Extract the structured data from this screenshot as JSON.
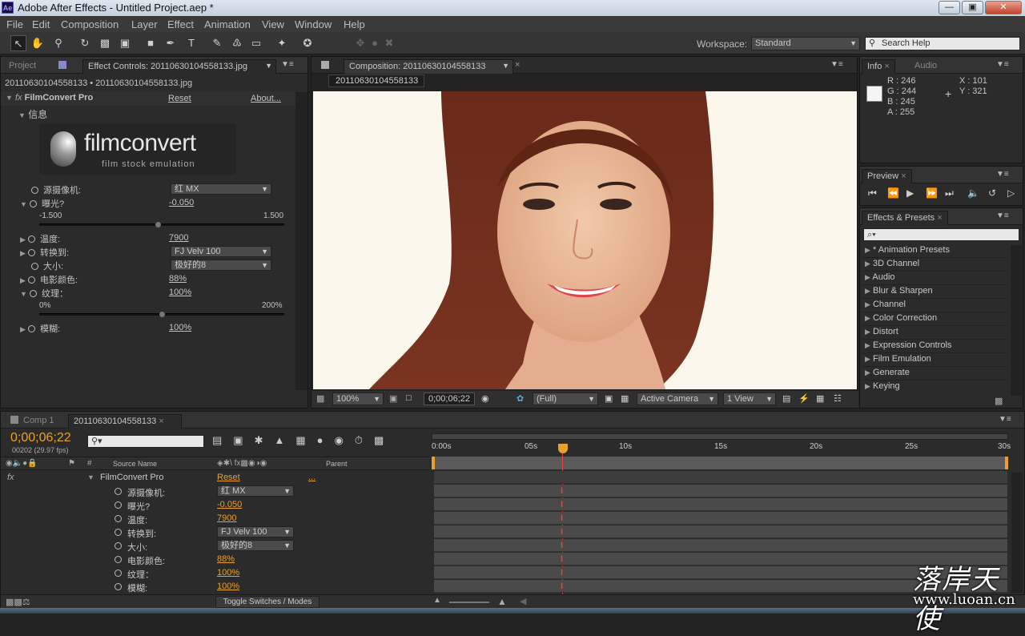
{
  "window": {
    "title": "Adobe After Effects - Untitled Project.aep *",
    "app_icon": "Ae"
  },
  "menu": [
    "File",
    "Edit",
    "Composition",
    "Layer",
    "Effect",
    "Animation",
    "View",
    "Window",
    "Help"
  ],
  "toolbar": {
    "workspace_label": "Workspace:",
    "workspace_value": "Standard",
    "search_placeholder": "Search Help"
  },
  "effect_controls": {
    "tab_project": "Project",
    "tab_effect": "Effect Controls: 20110630104558133.jpg",
    "breadcrumb": "20110630104558133 • 20110630104558133.jpg",
    "fx_label": "fx",
    "effect_name": "FilmConvert Pro",
    "reset": "Reset",
    "about": "About...",
    "group": "信息",
    "logo_main": "filmconvert",
    "logo_sub": "film stock emulation",
    "camera_label": "源摄像机:",
    "camera_value": "红  MX",
    "exposure_label": "曝光?",
    "exposure_value": "-0.050",
    "exposure_min": "-1.500",
    "exposure_max": "1.500",
    "exposure_level": 0.483,
    "temp_label": "温度:",
    "temp_value": "7900",
    "convert_label": "转换到:",
    "convert_value": "FJ Velv 100",
    "size_label": "大小:",
    "size_value": "极好的8",
    "filmcolor_label": "电影颜色:",
    "filmcolor_value": "88%",
    "grain_label": "纹理：",
    "grain_value": "100%",
    "grain_min": "0%",
    "grain_max": "200%",
    "grain_level": 0.5,
    "blur_label": "模糊:",
    "blur_value": "100%"
  },
  "composition": {
    "tab": "Composition: 20110630104558133",
    "comp_chip": "20110630104558133",
    "zoom": "100%",
    "timecode": "0;00;06;22",
    "resolution": "(Full)",
    "camera": "Active Camera",
    "views": "1 View"
  },
  "info": {
    "tab_info": "Info",
    "tab_audio": "Audio",
    "r": "R : 246",
    "g": "G : 244",
    "b": "B : 245",
    "a": "A : 255",
    "x": "X : 101",
    "y": "Y : 321",
    "swatch": "#f6f4f5"
  },
  "preview": {
    "tab": "Preview"
  },
  "effects_presets": {
    "tab": "Effects & Presets",
    "search": "⌕▾",
    "items": [
      "* Animation Presets",
      "3D Channel",
      "Audio",
      "Blur & Sharpen",
      "Channel",
      "Color Correction",
      "Distort",
      "Expression Controls",
      "Film Emulation",
      "Generate",
      "Keying"
    ]
  },
  "timeline": {
    "tab_comp1": "Comp 1",
    "tab_active": "20110630104558133",
    "timecode": "0;00;06;22",
    "frameinfo": "00202 (29.97 fps)",
    "col_source": "Source Name",
    "col_parent": "Parent",
    "col_num": "#",
    "ruler": [
      "0:00s",
      "05s",
      "10s",
      "15s",
      "20s",
      "25s",
      "30s"
    ],
    "effect_row": {
      "fx": "fx",
      "name": "FilmConvert Pro",
      "reset": "Reset",
      "dots": "..."
    },
    "props": [
      {
        "label": "源摄像机:",
        "value": "红  MX",
        "type": "dropdown"
      },
      {
        "label": "曝光?",
        "value": "-0.050",
        "type": "value"
      },
      {
        "label": "温度:",
        "value": "7900",
        "type": "value"
      },
      {
        "label": "转换到:",
        "value": "FJ Velv 100",
        "type": "dropdown"
      },
      {
        "label": "大小:",
        "value": "极好的8",
        "type": "dropdown"
      },
      {
        "label": "电影颜色:",
        "value": "88%",
        "type": "value"
      },
      {
        "label": "纹理：",
        "value": "100%",
        "type": "value"
      },
      {
        "label": "模糊:",
        "value": "100%",
        "type": "value"
      }
    ],
    "toggle": "Toggle Switches / Modes"
  },
  "watermark": {
    "script": "落岸天使",
    "url": "www.luoan.cn"
  },
  "colors": {
    "accent": "#e7a12c",
    "bg": "#2b2b2b",
    "playhead": "#e04444"
  }
}
